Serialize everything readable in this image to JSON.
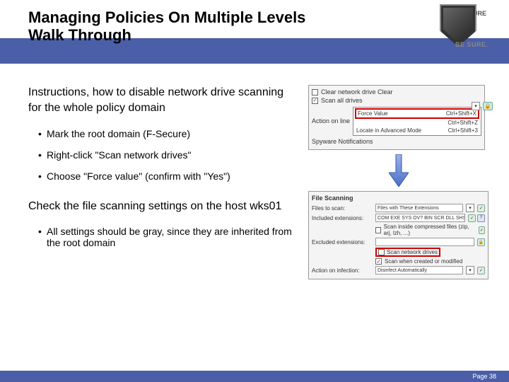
{
  "brand": {
    "name": "F-SECURE",
    "tagline": "BE SURE."
  },
  "title": "Managing Policies On Multiple Levels\nWalk Through",
  "intro": "Instructions, how to disable network drive scanning for the whole policy domain",
  "bullets": [
    "Mark the root domain (F-Secure)",
    "Right-click \"Scan network drives\"",
    "Choose \"Force value\" (confirm with \"Yes\")"
  ],
  "check_text": "Check the file scanning settings on the host wks01",
  "bullets2": [
    "All settings should be gray, since they are inherited from the root domain"
  ],
  "panel1": {
    "clear_label": "Clear network drive Clear",
    "scan_label": "Scan all drives",
    "action_line": "Action on line",
    "menu": [
      {
        "label": "Force Value",
        "shortcut": "Ctrl+Shift+X",
        "highlight": true
      },
      {
        "label": "",
        "shortcut": "Ctrl+Shift+Z"
      },
      {
        "label": "Locate in Advanced Mode",
        "shortcut": "Ctrl+Shift+3"
      }
    ],
    "spyware_label": "Spyware Notifications"
  },
  "panel2": {
    "title": "File Scanning",
    "files_to_scan": {
      "label": "Files to scan:",
      "value": "Files with These Extensions"
    },
    "included": {
      "label": "Included extensions:",
      "value": "COM EXE SYS OV? BIN SCR DLL SHS HTM HTA"
    },
    "scan_compressed": "Scan inside compressed files (zip, arj, lzh, ...)",
    "excluded": {
      "label": "Excluded extensions:",
      "value": ""
    },
    "scan_network": "Scan network drives",
    "scan_created": "Scan when created or modified",
    "action_infection": {
      "label": "Action on infection:",
      "value": "Disinfect Automatically"
    }
  },
  "footer": "Page 38"
}
